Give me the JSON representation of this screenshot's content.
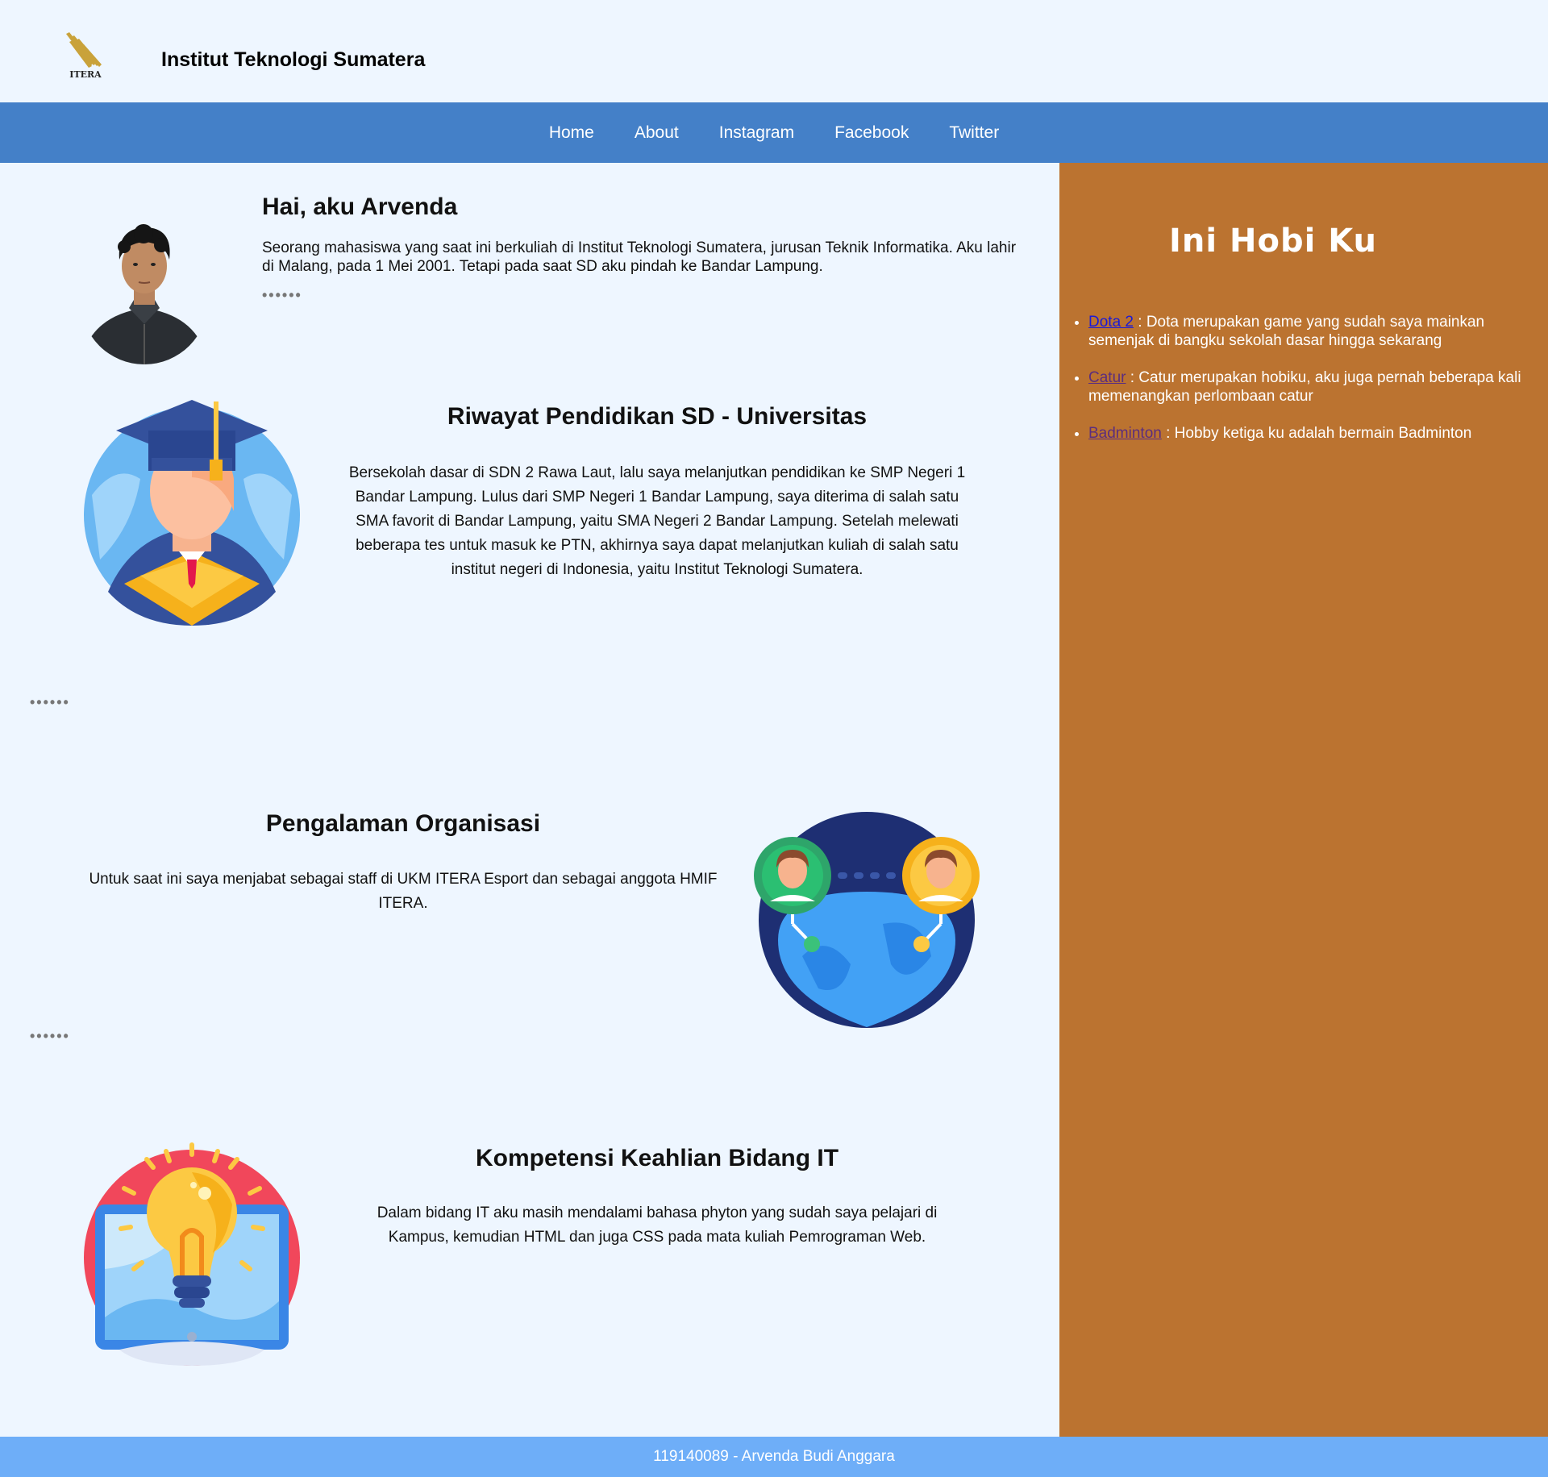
{
  "header": {
    "logo_text": "ITERA",
    "site_title": "Institut Teknologi Sumatera"
  },
  "nav": {
    "items": [
      {
        "label": "Home"
      },
      {
        "label": "About"
      },
      {
        "label": "Instagram"
      },
      {
        "label": "Facebook"
      },
      {
        "label": "Twitter"
      }
    ]
  },
  "intro": {
    "title": "Hai, aku Arvenda",
    "text": "Seorang mahasiswa yang saat ini berkuliah di Institut Teknologi Sumatera, jurusan Teknik Informatika. Aku lahir di Malang, pada 1 Mei 2001. Tetapi pada saat SD aku pindah ke Bandar Lampung.",
    "dots": "••••••"
  },
  "education": {
    "title": "Riwayat Pendidikan SD - Universitas",
    "text": "Bersekolah dasar di SDN 2 Rawa Laut, lalu saya melanjutkan pendidikan ke SMP Negeri 1 Bandar Lampung. Lulus dari SMP Negeri 1 Bandar Lampung, saya diterima di salah satu SMA favorit di Bandar Lampung, yaitu SMA Negeri 2 Bandar Lampung. Setelah melewati beberapa tes untuk masuk ke PTN, akhirnya saya dapat melanjutkan kuliah di salah satu institut negeri di Indonesia, yaitu Institut Teknologi Sumatera.",
    "dots": "••••••"
  },
  "organization": {
    "title": "Pengalaman Organisasi",
    "text": "Untuk saat ini saya menjabat sebagai staff di UKM ITERA Esport dan sebagai anggota HMIF ITERA.",
    "dots": "••••••"
  },
  "competence": {
    "title": "Kompetensi Keahlian Bidang IT",
    "text": "Dalam bidang IT aku masih mendalami bahasa phyton yang sudah saya pelajari di Kampus, kemudian HTML dan juga CSS pada mata kuliah Pemrograman Web."
  },
  "sidebar": {
    "title": "Ini Hobi Ku",
    "hobbies": [
      {
        "name": "Dota 2",
        "desc": " : Dota merupakan game yang sudah saya mainkan semenjak di bangku sekolah dasar hingga sekarang"
      },
      {
        "name": "Catur",
        "desc": " : Catur merupakan hobiku, aku juga pernah beberapa kali memenangkan perlombaan catur"
      },
      {
        "name": "Badminton",
        "desc": " : Hobby ketiga ku adalah bermain Badminton"
      }
    ]
  },
  "footer": {
    "text": "119140089 - Arvenda Budi Anggara"
  },
  "colors": {
    "nav": "#4480c8",
    "sidebar": "#bb7330",
    "footer": "#6eaef8",
    "background": "#eef6ff"
  }
}
